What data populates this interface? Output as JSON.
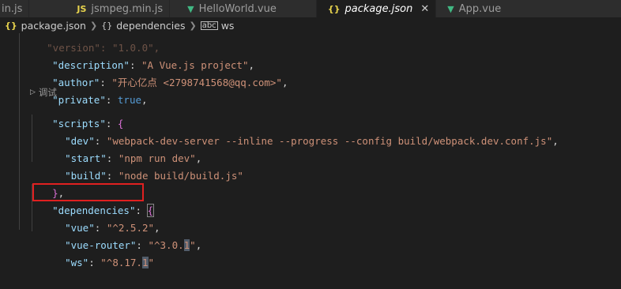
{
  "tabs": [
    {
      "label": "in.js",
      "icon": "js-file-icon"
    },
    {
      "label": "jsmpeg.min.js",
      "icon": "js-file-icon"
    },
    {
      "label": "HelloWorld.vue",
      "icon": "vue-file-icon"
    },
    {
      "label": "package.json",
      "icon": "json-file-icon",
      "active": true
    },
    {
      "label": "App.vue",
      "icon": "vue-file-icon"
    }
  ],
  "tab_icons": {
    "js": "JS",
    "json": "{}",
    "vue": "▼",
    "close": "✕"
  },
  "breadcrumb": {
    "file": "package.json",
    "object": "dependencies",
    "leaf": "ws",
    "file_icon": "{}",
    "object_icon": "{}",
    "leaf_icon": "abc"
  },
  "code": {
    "version_partial": "  \"version\": \"1.0.0\",",
    "description_key": "\"description\"",
    "description_val": "\"A Vue.js project\"",
    "author_key": "\"author\"",
    "author_val": "\"开心亿点 <2798741568@qq.com>\"",
    "private_key": "\"private\"",
    "private_val": "true",
    "codelens": "调试",
    "scripts_key": "\"scripts\"",
    "dev_key": "\"dev\"",
    "dev_val": "\"webpack-dev-server --inline --progress --config build/webpack.dev.conf.js\"",
    "start_key": "\"start\"",
    "start_val": "\"npm run dev\"",
    "build_key": "\"build\"",
    "build_val": "\"node build/build.js\"",
    "dependencies_key": "\"dependencies\"",
    "vue_key": "\"vue\"",
    "vue_val": "\"^2.5.2\"",
    "router_key": "\"vue-router\"",
    "router_val_a": "\"^3.0.",
    "router_val_b": "1",
    "router_val_c": "\"",
    "ws_key": "\"ws\"",
    "ws_val_a": "\"^8.17.",
    "ws_val_b": "1",
    "ws_val_c": "\""
  },
  "colors": {
    "background": "#1e1e1e",
    "key": "#9cdcfe",
    "string": "#ce9178",
    "boolean": "#569cd6",
    "highlight_box": "#e02020"
  }
}
